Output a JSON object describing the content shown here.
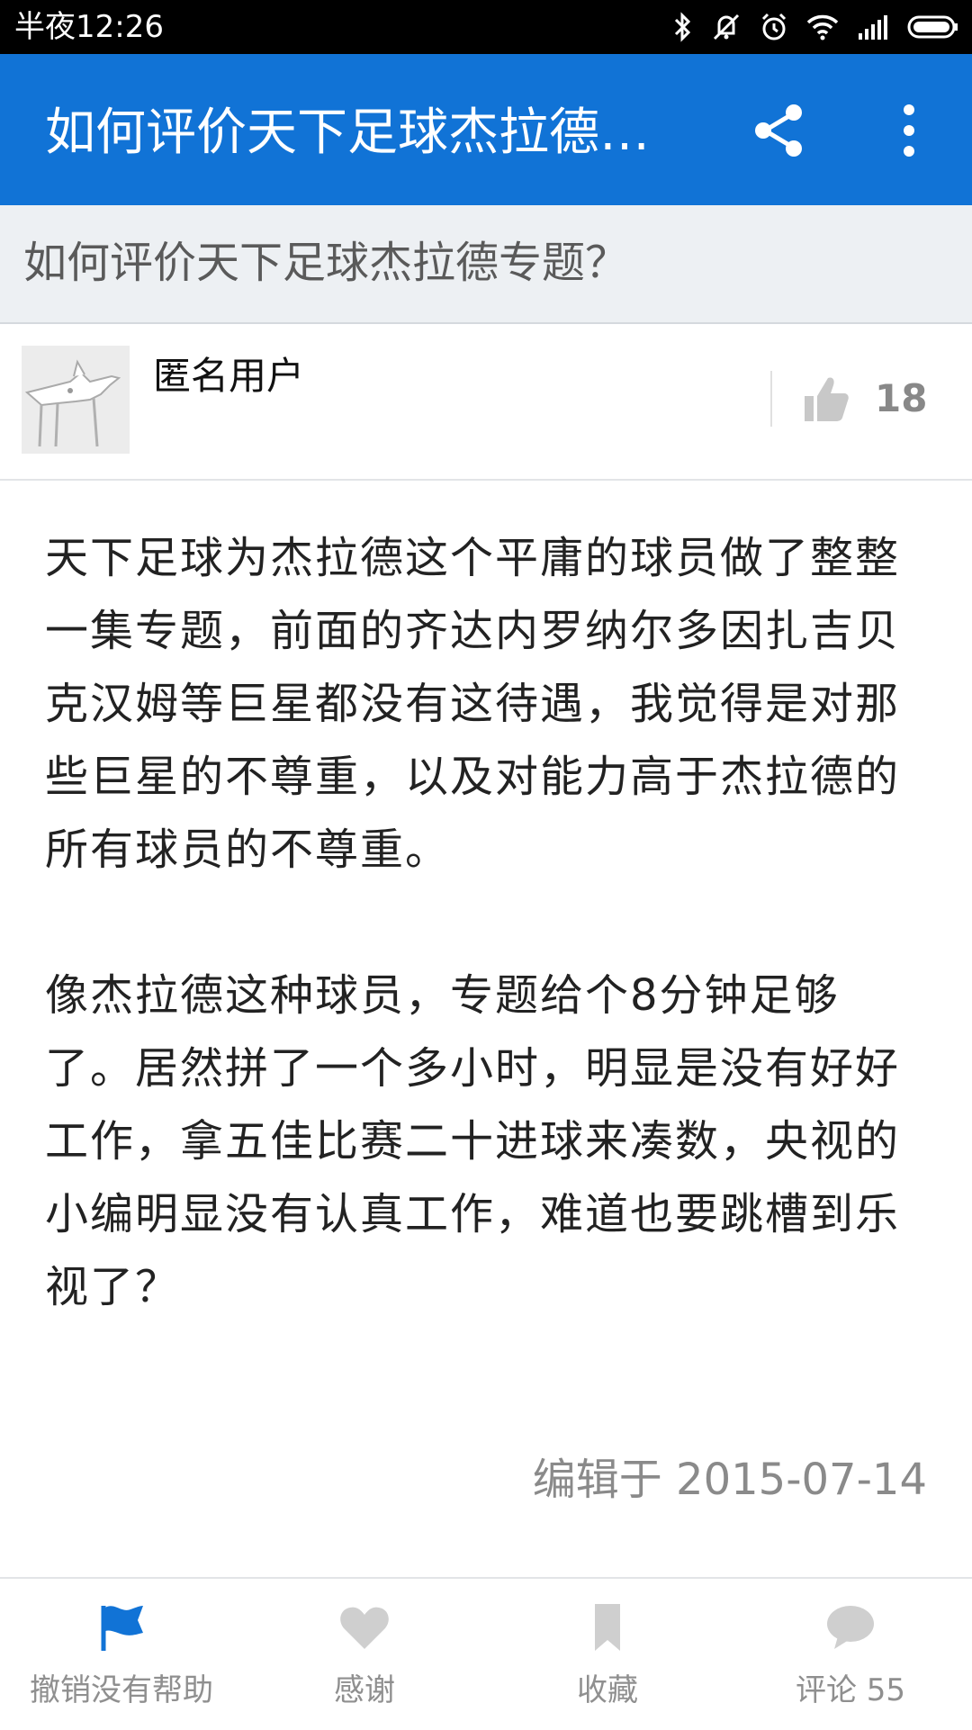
{
  "status_bar": {
    "time": "半夜12:26",
    "icons": [
      "bluetooth-icon",
      "mute-vibrate-icon",
      "alarm-icon",
      "wifi-icon",
      "signal-icon",
      "battery-icon"
    ]
  },
  "app_bar": {
    "title": "如何评价天下足球杰拉德专题？",
    "actions": [
      "share-icon",
      "more-icon"
    ],
    "color": "#1173d6"
  },
  "question": {
    "text": "如何评价天下足球杰拉德专题？"
  },
  "answer": {
    "author": "匿名用户",
    "vote_count": "18",
    "paragraphs": [
      "天下足球为杰拉德这个平庸的球员做了整整一集专题，前面的齐达内罗纳尔多因扎吉贝克汉姆等巨星都没有这待遇，我觉得是对那些巨星的不尊重，以及对能力高于杰拉德的所有球员的不尊重。",
      "像杰拉德这种球员，专题给个8分钟足够了。居然拼了一个多小时，明显是没有好好工作，拿五佳比赛二十进球来凑数，央视的小编明显没有认真工作，难道也要跳槽到乐视了？"
    ],
    "edited": "编辑于 2015-07-14"
  },
  "bottom_bar": {
    "tabs": [
      {
        "label": "撤销没有帮助",
        "icon": "flag-icon",
        "active": true
      },
      {
        "label": "感谢",
        "icon": "heart-icon"
      },
      {
        "label": "收藏",
        "icon": "bookmark-icon"
      },
      {
        "label": "评论 55",
        "icon": "comment-icon"
      }
    ],
    "active_color": "#1173d6",
    "inactive_color": "#cfcfcf"
  }
}
